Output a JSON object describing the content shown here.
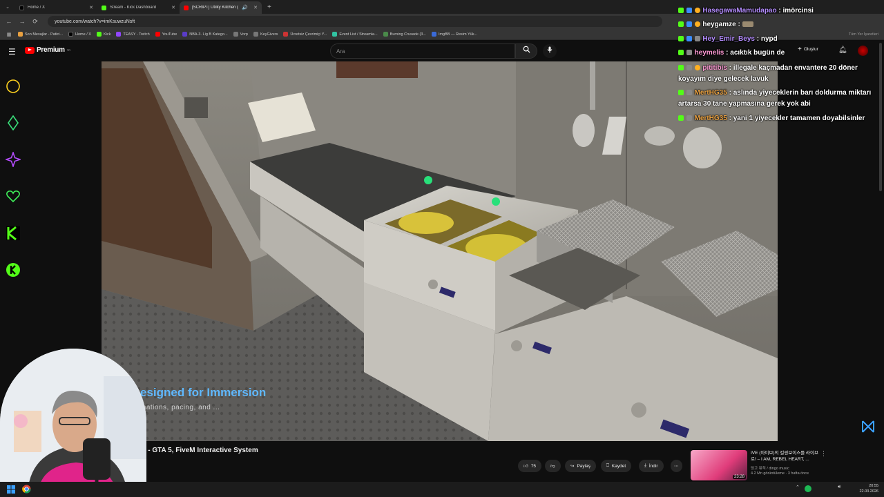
{
  "browser": {
    "tabs": [
      {
        "label": "Home / X",
        "color": "#000000"
      },
      {
        "label": "Stream - Kick Dashboard",
        "color": "#53fc18"
      },
      {
        "label": "[SCRIPT] Utility Kitchen (Ke",
        "color": "#ff0000"
      }
    ],
    "url": "youtube.com/watch?v=imKsuwzuNsft",
    "bookmarks": [
      {
        "label": "Son Mesajlar - Patici...",
        "color": "#e8a040"
      },
      {
        "label": "Home / X",
        "color": "#000000"
      },
      {
        "label": "Kick",
        "color": "#53fc18"
      },
      {
        "label": "TEASY - Twitch",
        "color": "#9146ff"
      },
      {
        "label": "YouTube",
        "color": "#ff0000"
      },
      {
        "label": "NBA-3. Lig B Katego...",
        "color": "#5a3cc8"
      },
      {
        "label": "Vorp",
        "color": "#888888"
      },
      {
        "label": "KeyGivers",
        "color": "#888888"
      },
      {
        "label": "Ücretsiz Çevrimiçi Y...",
        "color": "#cc3333"
      },
      {
        "label": "Event List / Streamla...",
        "color": "#31c3a2"
      },
      {
        "label": "Burning Crusade (3...",
        "color": "#4a8a4a"
      },
      {
        "label": "ImgBB — Resim Yük...",
        "color": "#3a6ad8"
      }
    ],
    "all_bookmarks": "Tüm Yer İşaretleri"
  },
  "youtube": {
    "logo_text": "Premium",
    "logo_country": "TR",
    "search_placeholder": "Ara",
    "create_label": "Oluştur",
    "video_title": "b) - GTA 5, FiveM Interactive System",
    "caption_title": "esigned for Immersion",
    "caption_sub": "mations, pacing, and ...",
    "actions": {
      "likes": "75",
      "share": "Paylaş",
      "save": "Kaydet",
      "download": "İndir"
    },
    "recommended": {
      "title": "IVE (아이브)의 킬링보이스를 라이브로! – I AM, REBEL HEART, ...",
      "channel": "딩고 뮤직 / dingo music",
      "meta": "4.2 Mn görüntüleme · 3 hafta önce",
      "duration": "23:28"
    }
  },
  "chat": [
    {
      "user": "HasegawaMamudapao",
      "color": "#b48cff",
      "message": "imörcinsi"
    },
    {
      "user": "heygamze",
      "color": "#ffffff",
      "message": ""
    },
    {
      "user": "Hey_Emir_Beys",
      "color": "#b48cff",
      "message": "nypd"
    },
    {
      "user": "heymelis",
      "color": "#ff9ad5",
      "message": "acıktık bugün de"
    },
    {
      "user": "pititibis",
      "color": "#ff9ad5",
      "message": "illegale kaçmadan envantere 20 döner koyayım diye gelecek lavuk"
    },
    {
      "user": "MertHG35",
      "color": "#e8a040",
      "message": "aslında yiyeceklerin barı doldurma miktarı artarsa 30 tane yapmasına gerek yok abi"
    },
    {
      "user": "MertHG35",
      "color": "#e8a040",
      "message": "yani 1 yiyecekler tamamen doyabilsinler"
    }
  ],
  "taskbar": {
    "time": "20:55",
    "date": "22.03.2026"
  }
}
